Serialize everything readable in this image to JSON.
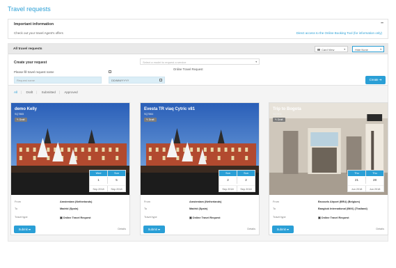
{
  "page": {
    "title": "Travel requests"
  },
  "info": {
    "title": "Important information",
    "collapse": "–",
    "text": "Check out your travel Agent's offers",
    "link": "Direct access to the Online Booking Tool (for information only)"
  },
  "requests": {
    "title": "All travel requests",
    "view_label": "Card View",
    "sort_label": "Hide None",
    "create_label": "Create your request",
    "model_placeholder": "Select a model to request a service",
    "model_hint": "Online Travel Request",
    "name_label": "Please fill travel request name",
    "name_placeholder": "Request name",
    "date_placeholder": "DD/MM/YYYY",
    "create_button": "Create ➔"
  },
  "filters": [
    "All",
    "Draft",
    "Submitted",
    "Approved"
  ],
  "labels": {
    "from": "From",
    "to": "To",
    "travel_type": "Travel type",
    "submit": "Submit ➦",
    "details": "Details"
  },
  "cards": [
    {
      "title": "demo Kelly",
      "subtitle": "SQ7865",
      "status": "Draft",
      "days": [
        "Wed",
        "Sun"
      ],
      "nums": [
        "1",
        "5"
      ],
      "months": [
        "Sep 2018",
        "Sep 2018"
      ],
      "from": "Amsterdam (Netherlands)",
      "to": "Madrid (Spain)",
      "type": "Online Travel Request"
    },
    {
      "title": "Evesta TR viaq Cytric v81",
      "subtitle": "SQ7864",
      "status": "Draft",
      "days": [
        "Sun",
        "Sun"
      ],
      "nums": [
        "2",
        "2"
      ],
      "months": [
        "Sep 2018",
        "Sep 2018"
      ],
      "from": "Amsterdam (Netherlands)",
      "to": "Madrid (Spain)",
      "type": "Online Travel Request"
    },
    {
      "title": "Trip to Bogota",
      "subtitle": "SQ7811",
      "status": "Draft",
      "days": [
        "Thu",
        "Thu"
      ],
      "nums": [
        "21",
        "28"
      ],
      "months": [
        "Jun 2018",
        "Jun 2018"
      ],
      "from": "Brussels Airport (BRU) (Belgium)",
      "to": "Bangkok International (BKK) (Thailand)",
      "type": "Online Travel Request"
    }
  ],
  "colors": {
    "accent": "#2a9fd6",
    "badge": "#7c7c7c"
  }
}
